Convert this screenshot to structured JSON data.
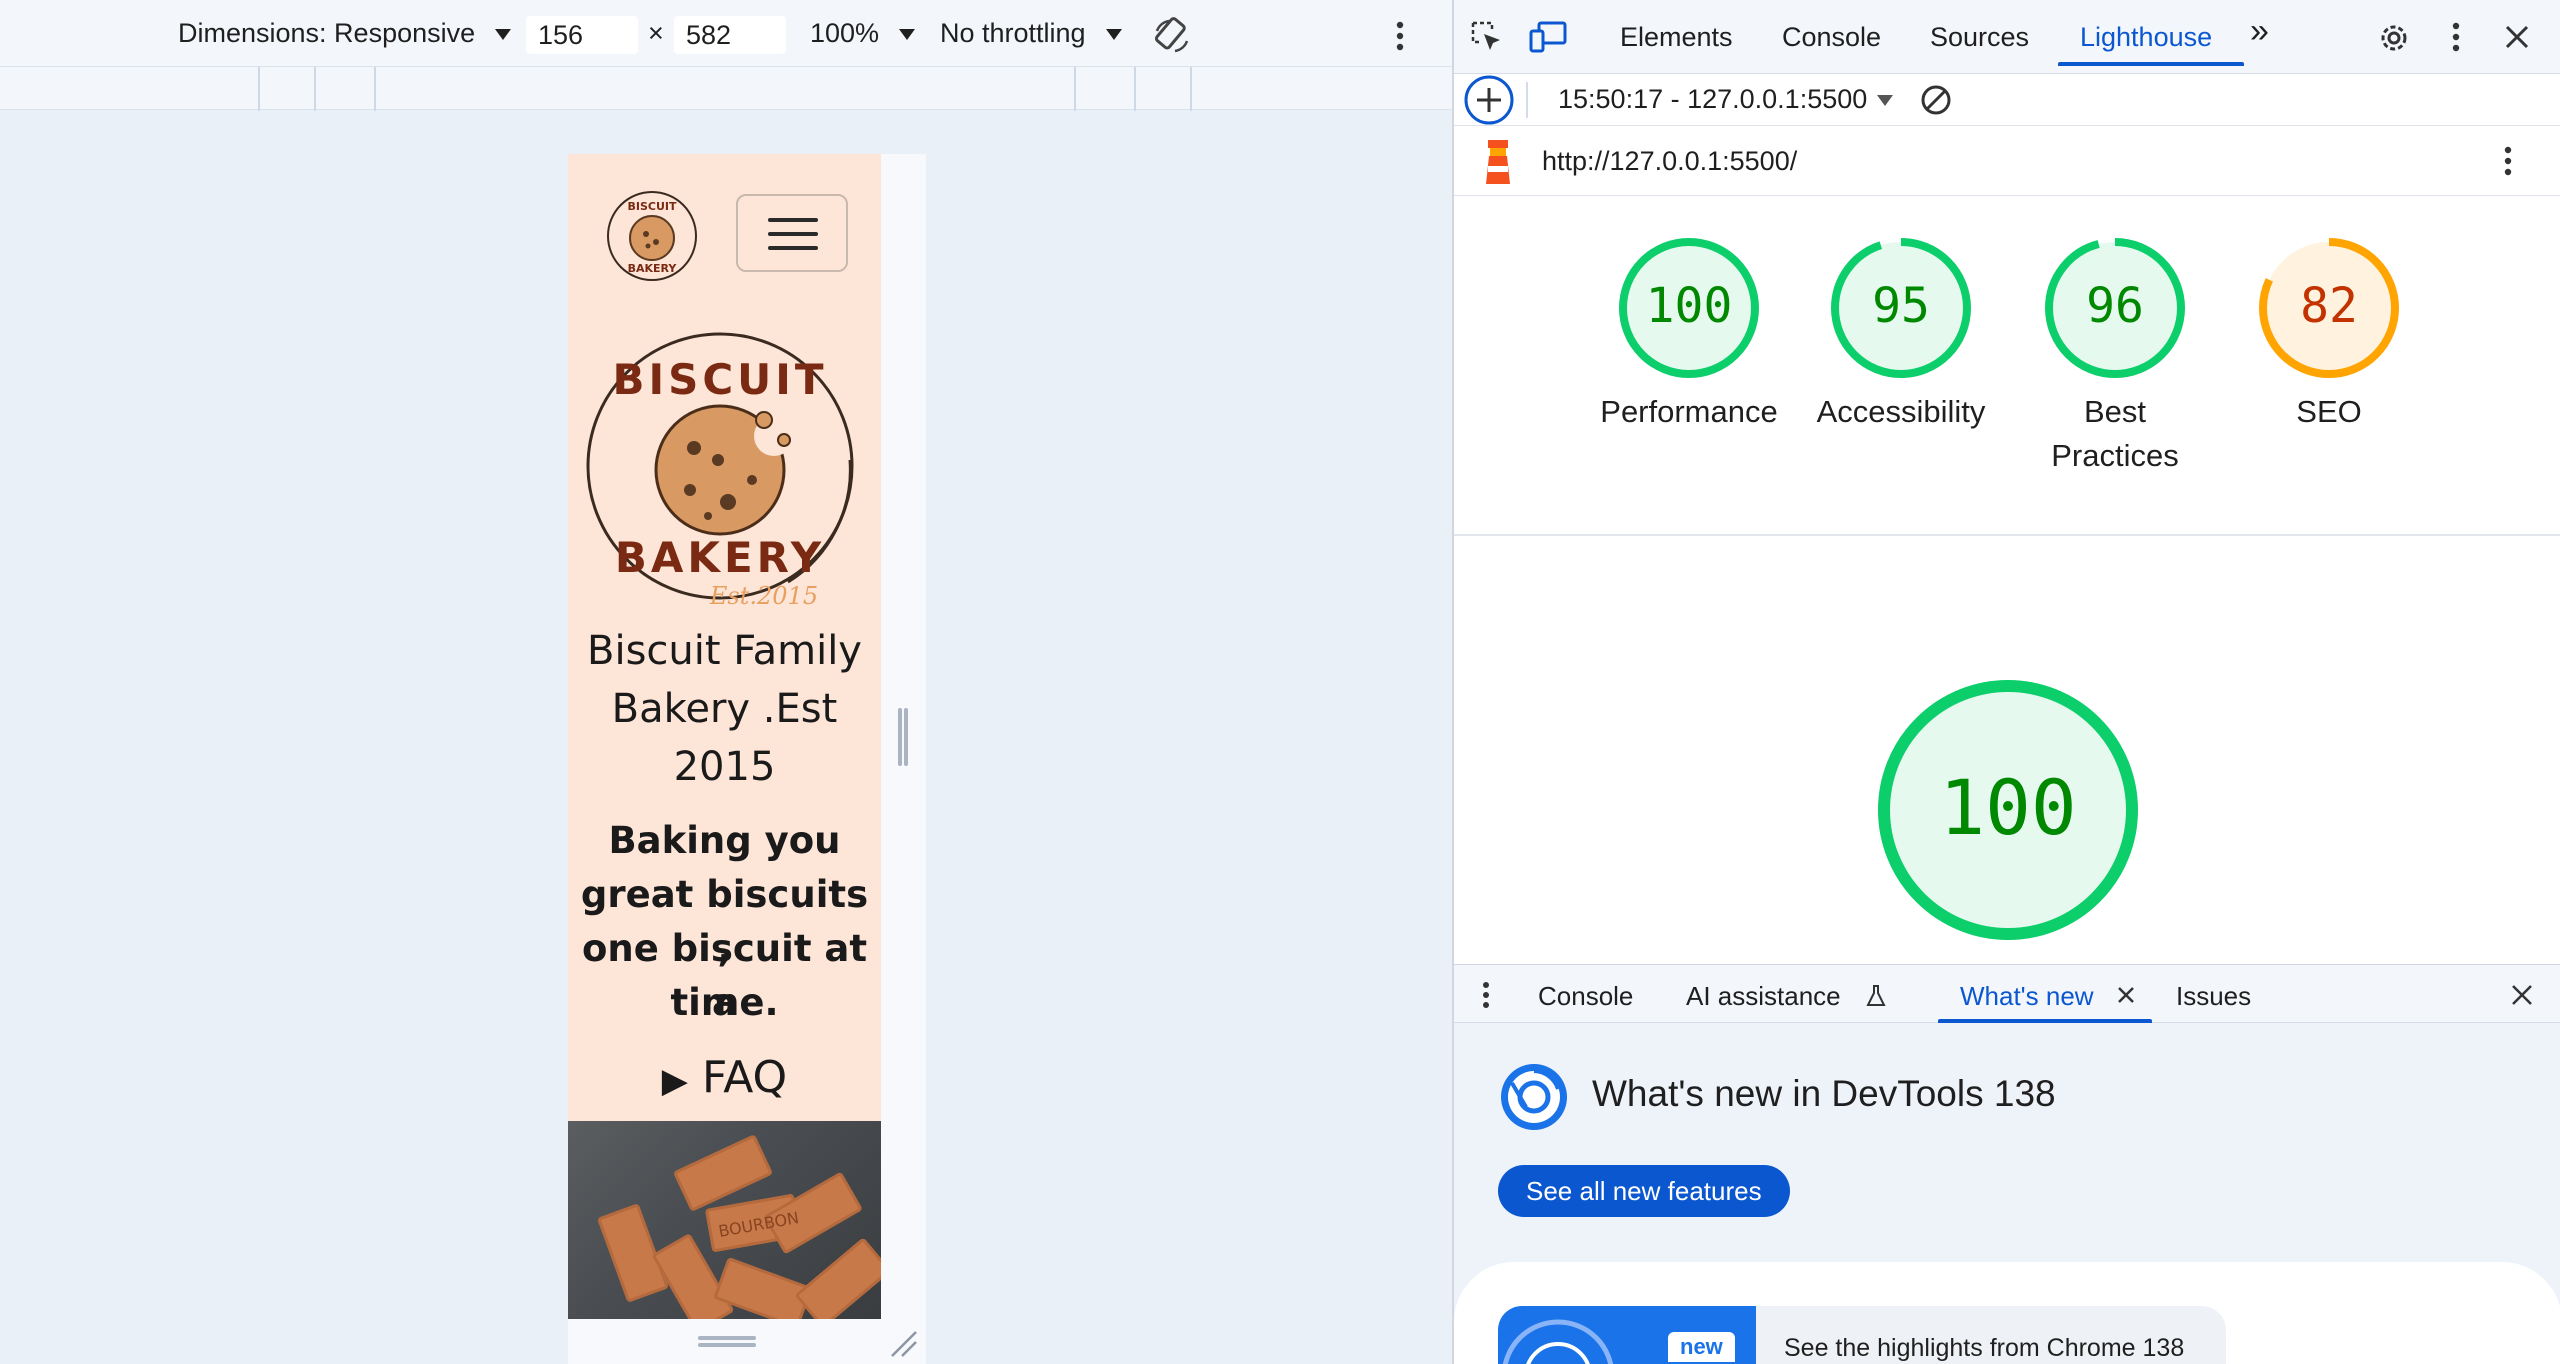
{
  "device_toolbar": {
    "dimensions_label": "Dimensions: Responsive",
    "width": "156",
    "times": "×",
    "height": "582",
    "zoom": "100%",
    "throttling": "No throttling"
  },
  "site": {
    "logo_small_text": "BISCUIT BAKERY",
    "logo_big_top": "BISCUIT",
    "logo_big_bottom": "BAKERY",
    "logo_est": "Est.2015",
    "title_lines": [
      "Biscuit Family",
      "Bakery .Est",
      "2015"
    ],
    "tagline_lines": [
      "Baking you",
      "great biscuits ,",
      "one biscuit at a",
      "time."
    ],
    "faq": "FAQ",
    "faq_marker": "▶",
    "biscuit_stamp": "BOURBON"
  },
  "devtools": {
    "tabs": [
      "Elements",
      "Console",
      "Sources",
      "Lighthouse"
    ],
    "active_tab": "Lighthouse",
    "more_tabs": "»",
    "report_selector": "15:50:17 - 127.0.0.1:5500",
    "url": "http://127.0.0.1:5500/",
    "scores": [
      {
        "value": 100,
        "label": "Performance",
        "color": "#0cce6b",
        "text_color": "#008800",
        "bg": "#e6f9ee"
      },
      {
        "value": 95,
        "label": "Accessibility",
        "color": "#0cce6b",
        "text_color": "#008800",
        "bg": "#e6f9ee"
      },
      {
        "value": 96,
        "label_line1": "Best",
        "label_line2": "Practices",
        "color": "#0cce6b",
        "text_color": "#008800",
        "bg": "#e6f9ee"
      },
      {
        "value": 82,
        "label": "SEO",
        "color": "#ffa400",
        "text_color": "#c33300",
        "bg": "#fff3e0"
      }
    ],
    "big_score": {
      "value": 100,
      "color": "#0cce6b",
      "text_color": "#008800",
      "bg": "#e6f9ee"
    }
  },
  "drawer": {
    "tabs": [
      "Console",
      "AI assistance",
      "What's new",
      "Issues"
    ],
    "active_tab": "What's new",
    "title": "What's new in DevTools 138",
    "see_all_button": "See all new features",
    "card_badge": "new",
    "card_text": "See the highlights from Chrome 138"
  },
  "colors": {
    "accent": "#0b57d0",
    "pass_green": "#0cce6b",
    "average_orange": "#ffa400",
    "page_bg": "#fde5d8"
  }
}
